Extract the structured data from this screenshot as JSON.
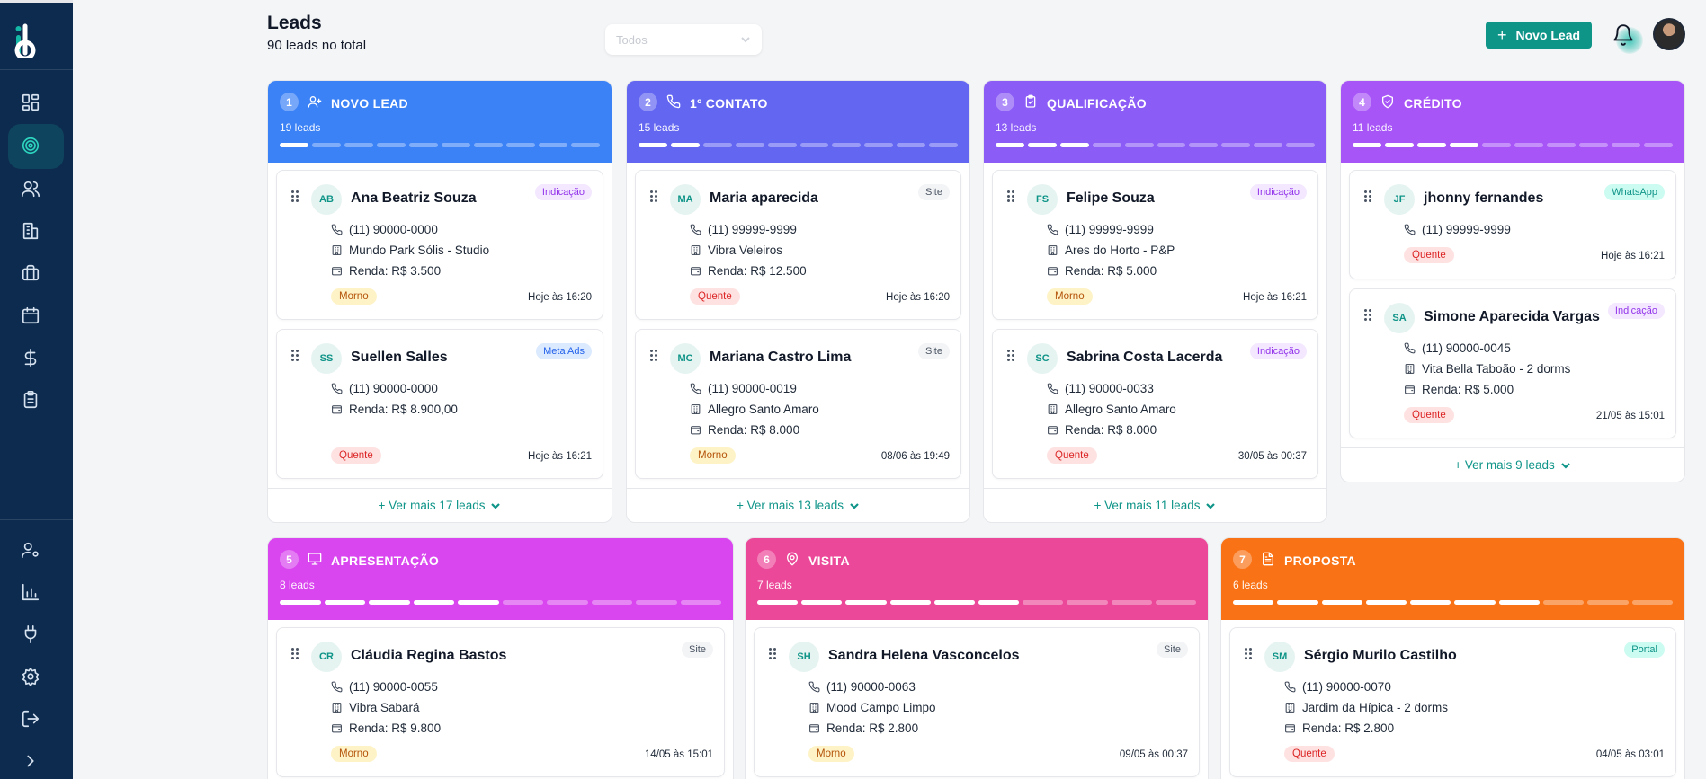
{
  "header": {
    "title": "Leads",
    "subtitle": "90 leads no total",
    "filter_value": "Todos",
    "novo_lead": "Novo Lead"
  },
  "columns": [
    {
      "num": "1",
      "title": "NOVO LEAD",
      "count": "19 leads",
      "color": "#3b82f6",
      "progress": 0.1,
      "icon": "user-plus-icon",
      "ver_mais": "+ Ver mais 17 leads",
      "cards": [
        {
          "initials": "AB",
          "name": "Ana Beatriz Souza",
          "source": "Indicação",
          "phone": "(11) 90000-0000",
          "project": "Mundo Park Sólis - Studio",
          "income": "Renda: R$ 3.500",
          "temp": "Morno",
          "when": "Hoje às 16:20"
        },
        {
          "initials": "SS",
          "name": "Suellen Salles",
          "source": "Meta Ads",
          "phone": "(11) 90000-0000",
          "project": "",
          "income": "Renda: R$ 8.900,00",
          "temp": "Quente",
          "when": "Hoje às 16:21"
        }
      ]
    },
    {
      "num": "2",
      "title": "1º CONTATO",
      "count": "15 leads",
      "color": "#6366f1",
      "progress": 0.2,
      "icon": "phone-icon",
      "ver_mais": "+ Ver mais 13 leads",
      "cards": [
        {
          "initials": "MA",
          "name": "Maria aparecida",
          "source": "Site",
          "phone": "(11) 99999-9999",
          "project": "Vibra Veleiros",
          "income": "Renda: R$ 12.500",
          "temp": "Quente",
          "when": "Hoje às 16:20"
        },
        {
          "initials": "MC",
          "name": "Mariana Castro Lima",
          "source": "Site",
          "phone": "(11) 90000-0019",
          "project": "Allegro Santo Amaro",
          "income": "Renda: R$ 8.000",
          "temp": "Morno",
          "when": "08/06 às 19:49"
        }
      ]
    },
    {
      "num": "3",
      "title": "QUALIFICAÇÃO",
      "count": "13 leads",
      "color": "#8b5cf6",
      "progress": 0.3,
      "icon": "clipboard-check-icon",
      "ver_mais": "+ Ver mais 11 leads",
      "cards": [
        {
          "initials": "FS",
          "name": "Felipe Souza",
          "source": "Indicação",
          "phone": "(11) 99999-9999",
          "project": "Ares do Horto - P&P",
          "income": "Renda: R$ 5.000",
          "temp": "Morno",
          "when": "Hoje às 16:21"
        },
        {
          "initials": "SC",
          "name": "Sabrina Costa Lacerda",
          "source": "Indicação",
          "phone": "(11) 90000-0033",
          "project": "Allegro Santo Amaro",
          "income": "Renda: R$ 8.000",
          "temp": "Quente",
          "when": "30/05 às 00:37"
        }
      ]
    },
    {
      "num": "4",
      "title": "CRÉDITO",
      "count": "11 leads",
      "color": "#a855f7",
      "progress": 0.4,
      "icon": "shield-check-icon",
      "ver_mais": "+ Ver mais 9 leads",
      "cards": [
        {
          "initials": "JF",
          "name": "jhonny fernandes",
          "source": "WhatsApp",
          "phone": "(11) 99999-9999",
          "project": "",
          "income": "",
          "temp": "Quente",
          "when": "Hoje às 16:21"
        },
        {
          "initials": "SA",
          "name": "Simone Aparecida Vargas",
          "source": "Indicação",
          "phone": "(11) 90000-0045",
          "project": "Vita Bella Taboão - 2 dorms",
          "income": "Renda: R$ 5.000",
          "temp": "Quente",
          "when": "21/05 às 15:01"
        }
      ]
    },
    {
      "num": "5",
      "title": "APRESENTAÇÃO",
      "count": "8 leads",
      "color": "#d946ef",
      "progress": 0.5,
      "icon": "monitor-icon",
      "ver_mais": "",
      "cards": [
        {
          "initials": "CR",
          "name": "Cláudia Regina Bastos",
          "source": "Site",
          "phone": "(11) 90000-0055",
          "project": "Vibra Sabará",
          "income": "Renda: R$ 9.800",
          "temp": "Morno",
          "when": "14/05 às 15:01"
        }
      ]
    },
    {
      "num": "6",
      "title": "VISITA",
      "count": "7 leads",
      "color": "#ec4899",
      "progress": 0.6,
      "icon": "map-pin-icon",
      "ver_mais": "",
      "cards": [
        {
          "initials": "SH",
          "name": "Sandra Helena Vasconcelos",
          "source": "Site",
          "phone": "(11) 90000-0063",
          "project": "Mood Campo Limpo",
          "income": "Renda: R$ 2.800",
          "temp": "Morno",
          "when": "09/05 às 00:37"
        }
      ]
    },
    {
      "num": "7",
      "title": "PROPOSTA",
      "count": "6 leads",
      "color": "#f97316",
      "progress": 0.7,
      "icon": "file-text-icon",
      "ver_mais": "",
      "cards": [
        {
          "initials": "SM",
          "name": "Sérgio Murilo Castilho",
          "source": "Portal",
          "phone": "(11) 90000-0070",
          "project": "Jardim da Hípica - 2 dorms",
          "income": "Renda: R$ 2.800",
          "temp": "Quente",
          "when": "04/05 às 03:01"
        }
      ]
    }
  ]
}
